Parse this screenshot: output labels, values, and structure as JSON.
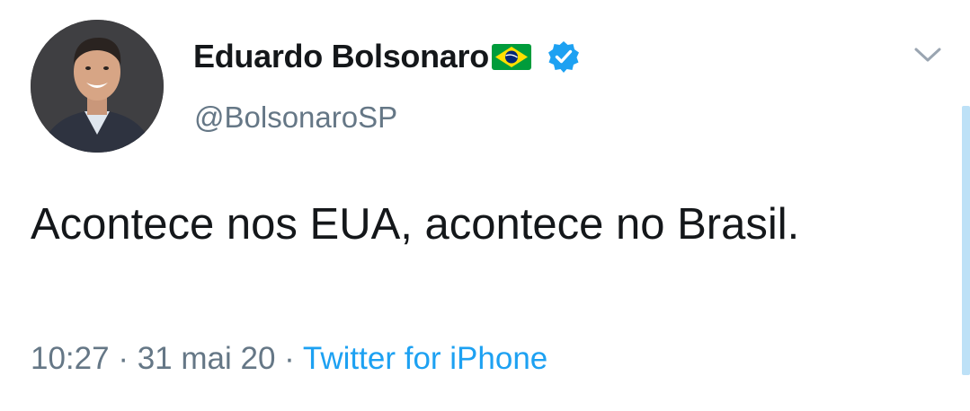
{
  "author": {
    "display_name": "Eduardo Bolsonaro",
    "handle": "@BolsonaroSP",
    "verified": true,
    "flag_icon": "brazil-flag-icon",
    "avatar": "profile-photo"
  },
  "tweet": {
    "text": "Acontece nos EUA, acontece no Brasil.",
    "time": "10:27",
    "separator": "·",
    "date": "31 mai 20",
    "source": "Twitter for iPhone"
  },
  "menu": {
    "icon": "chevron-down-icon"
  },
  "colors": {
    "text": "#14171a",
    "secondary": "#657786",
    "accent": "#1da1f2",
    "flag_green": "#009c3b",
    "flag_yellow": "#ffdf00",
    "flag_blue": "#002776"
  }
}
